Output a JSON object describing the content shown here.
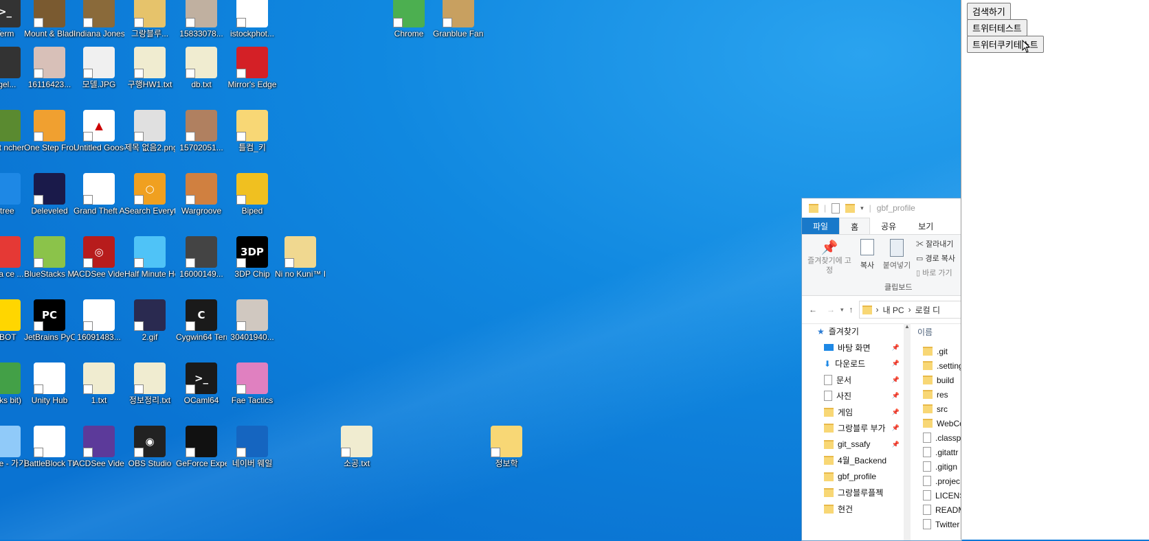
{
  "desktop": {
    "icons": [
      {
        "label": "Term",
        "color": "#333333",
        "glyph": ">_"
      },
      {
        "label": "Mount & Blade II ...",
        "color": "#7a5a30",
        "glyph": ""
      },
      {
        "label": "Indiana Jones an...",
        "color": "#8a6a3a",
        "glyph": ""
      },
      {
        "label": "그랑블루...",
        "color": "#e6c36b",
        "glyph": ""
      },
      {
        "label": "15833078...",
        "color": "#c0b0a0",
        "glyph": ""
      },
      {
        "label": "istockphot...",
        "color": "#ffffff",
        "glyph": ""
      },
      {
        "label": "Chrome",
        "color": "#4caf50",
        "glyph": ""
      },
      {
        "label": "Granblue Fantasy",
        "color": "#c8a060",
        "glyph": ""
      },
      {
        "label": "ngel...",
        "color": "#333333",
        "glyph": ""
      },
      {
        "label": "16116423...",
        "color": "#d8c0b8",
        "glyph": ""
      },
      {
        "label": "모델.JPG",
        "color": "#f0f0f0",
        "glyph": ""
      },
      {
        "label": "구행HW1.txt",
        "color": "#f0ecd0",
        "glyph": ""
      },
      {
        "label": "db.txt",
        "color": "#f0ecd0",
        "glyph": ""
      },
      {
        "label": "Mirror's Edge",
        "color": "#d42026",
        "glyph": ""
      },
      {
        "label": "craft ncher",
        "color": "#5a8a30",
        "glyph": ""
      },
      {
        "label": "One Step From Eden",
        "color": "#f0a030",
        "glyph": ""
      },
      {
        "label": "Untitled Goose Game",
        "color": "#ffffff",
        "glyph": "▲"
      },
      {
        "label": "제목 없음2.png",
        "color": "#e0e0e0",
        "glyph": ""
      },
      {
        "label": "15702051...",
        "color": "#b08060",
        "glyph": ""
      },
      {
        "label": "틀컴_키",
        "color": "#f8d775",
        "glyph": ""
      },
      {
        "label": "etree",
        "color": "#1e88e5",
        "glyph": ""
      },
      {
        "label": "Deleveled",
        "color": "#1a1a4a",
        "glyph": ""
      },
      {
        "label": "Grand Theft Auto V",
        "color": "#ffffff",
        "glyph": ""
      },
      {
        "label": "Search Everything",
        "color": "#f0a020",
        "glyph": "○"
      },
      {
        "label": "Wargroove",
        "color": "#d08040",
        "glyph": ""
      },
      {
        "label": "Biped",
        "color": "#f0c020",
        "glyph": ""
      },
      {
        "label": "Data ce ...",
        "color": "#e53935",
        "glyph": ""
      },
      {
        "label": "BlueStacks Multi-Insta...",
        "color": "#8bc34a",
        "glyph": ""
      },
      {
        "label": "ACDSee Video Re...",
        "color": "#b71c1c",
        "glyph": "◎"
      },
      {
        "label": "Half Minute Hero Supe...",
        "color": "#4fc3f7",
        "glyph": ""
      },
      {
        "label": "16000149...",
        "color": "#444444",
        "glyph": ""
      },
      {
        "label": "3DP Chip",
        "color": "#000000",
        "glyph": "3DP"
      },
      {
        "label": "Ni no Kuni™ II Revenant...",
        "color": "#f0d890",
        "glyph": ""
      },
      {
        "label": "UBOT",
        "color": "#ffd600",
        "glyph": ""
      },
      {
        "label": "JetBrains PyCharm ...",
        "color": "#000000",
        "glyph": "PC"
      },
      {
        "label": "16091483...",
        "color": "#ffffff",
        "glyph": ""
      },
      {
        "label": "2.gif",
        "color": "#2a2a50",
        "glyph": ""
      },
      {
        "label": "Cygwin64 Terminal",
        "color": "#1a1a1a",
        "glyph": "C"
      },
      {
        "label": "30401940...",
        "color": "#d0c8c0",
        "glyph": ""
      },
      {
        "label": "tacks bit)",
        "color": "#43a047",
        "glyph": ""
      },
      {
        "label": "Unity Hub",
        "color": "#ffffff",
        "glyph": ""
      },
      {
        "label": "1.txt",
        "color": "#f0ecd0",
        "glyph": ""
      },
      {
        "label": "정보정리.txt",
        "color": "#f0ecd0",
        "glyph": ""
      },
      {
        "label": "OCaml64",
        "color": "#1a1a1a",
        "glyph": ">_"
      },
      {
        "label": "Fae Tactics",
        "color": "#e080c0",
        "glyph": ""
      },
      {
        "label": "n.exe - 가기",
        "color": "#90caf9",
        "glyph": ""
      },
      {
        "label": "BattleBlock Theater",
        "color": "#ffffff",
        "glyph": ""
      },
      {
        "label": "ACDSee Video Stud...",
        "color": "#5c3a9a",
        "glyph": ""
      },
      {
        "label": "OBS Studio",
        "color": "#222222",
        "glyph": "◉"
      },
      {
        "label": "GeForce Experience",
        "color": "#111111",
        "glyph": ""
      },
      {
        "label": "네이버 웨일",
        "color": "#1565c0",
        "glyph": ""
      },
      {
        "label": "소공.txt",
        "color": "#f0ecd0",
        "glyph": ""
      },
      {
        "label": "정보학",
        "color": "#f8d775",
        "glyph": ""
      }
    ]
  },
  "browser": {
    "buttons": [
      "검색하기",
      "트위터테스트",
      "트위터쿠키테스트"
    ]
  },
  "explorer": {
    "title": "gbf_profile",
    "tabs": [
      "파일",
      "홈",
      "공유",
      "보기"
    ],
    "ribbon": {
      "pin_label": "즐겨찾기에 고정",
      "copy_label": "복사",
      "paste_label": "붙여넣기",
      "cut_label": "잘라내기",
      "copy_path_label": "경로 복사",
      "paste_shortcut_label": "바로 가기",
      "group_label": "클립보드"
    },
    "address": [
      "내 PC",
      "로컬 디"
    ],
    "nav": [
      {
        "label": "즐겨찾기"
      },
      {
        "label": "바탕 화면"
      },
      {
        "label": "다운로드"
      },
      {
        "label": "문서"
      },
      {
        "label": "사진"
      },
      {
        "label": "게임"
      },
      {
        "label": "그랑블루 부가"
      },
      {
        "label": "git_ssafy"
      },
      {
        "label": "4월_Backend"
      },
      {
        "label": "gbf_profile"
      },
      {
        "label": "그랑블루플젝"
      },
      {
        "label": "현건"
      }
    ],
    "column_header": "이름",
    "files": [
      {
        "name": ".git",
        "type": "folder"
      },
      {
        "name": ".settings",
        "type": "folder"
      },
      {
        "name": "build",
        "type": "folder"
      },
      {
        "name": "res",
        "type": "folder"
      },
      {
        "name": "src",
        "type": "folder"
      },
      {
        "name": "WebCo",
        "type": "folder"
      },
      {
        "name": ".classp",
        "type": "file"
      },
      {
        "name": ".gitattr",
        "type": "file"
      },
      {
        "name": ".gitign",
        "type": "file"
      },
      {
        "name": ".projec",
        "type": "file"
      },
      {
        "name": "LICENS",
        "type": "file"
      },
      {
        "name": "READM",
        "type": "file"
      },
      {
        "name": "Twitter",
        "type": "file"
      }
    ]
  }
}
